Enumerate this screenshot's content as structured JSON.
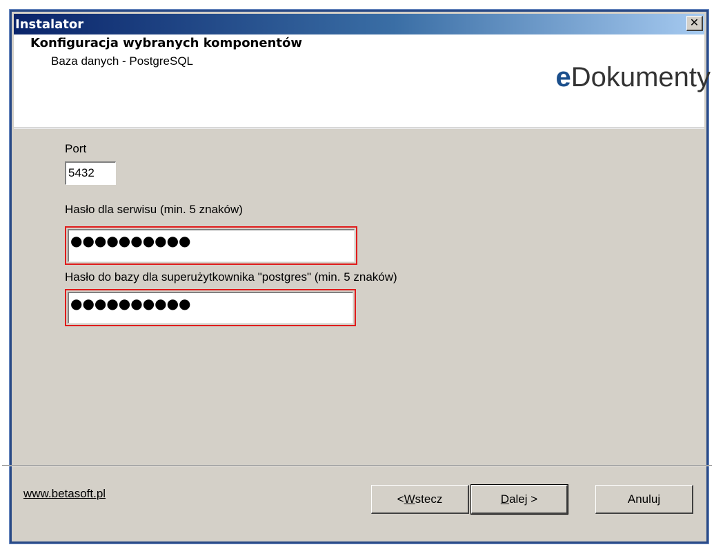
{
  "window": {
    "title": "Instalator",
    "close_symbol": "✕"
  },
  "header": {
    "title": "Konfiguracja wybranych komponentów",
    "subtitle": "Baza danych - PostgreSQL",
    "logo_prefix": "e",
    "logo_rest": "Dokumenty",
    "logo_color": "#1b4f8c"
  },
  "form": {
    "port_label": "Port",
    "port_value": "5432",
    "service_password_label": "Hasło dla serwisu (min. 5 znaków)",
    "service_password_mask": "●●●●●●●●●●",
    "db_password_label": "Hasło do bazy dla superużytkownika \"postgres\" (min. 5 znaków)",
    "db_password_mask": "●●●●●●●●●●",
    "highlight_color": "#e01b1b"
  },
  "footer": {
    "link_text": "www.betasoft.pl",
    "back_prefix": "< ",
    "back_accel": "W",
    "back_rest": "stecz",
    "next_accel": "D",
    "next_rest": "alej >",
    "cancel_label": "Anuluj"
  },
  "colors": {
    "titlebar_start": "#0a246a",
    "titlebar_end": "#a6caf0",
    "dialog_bg": "#d4d0c8"
  }
}
